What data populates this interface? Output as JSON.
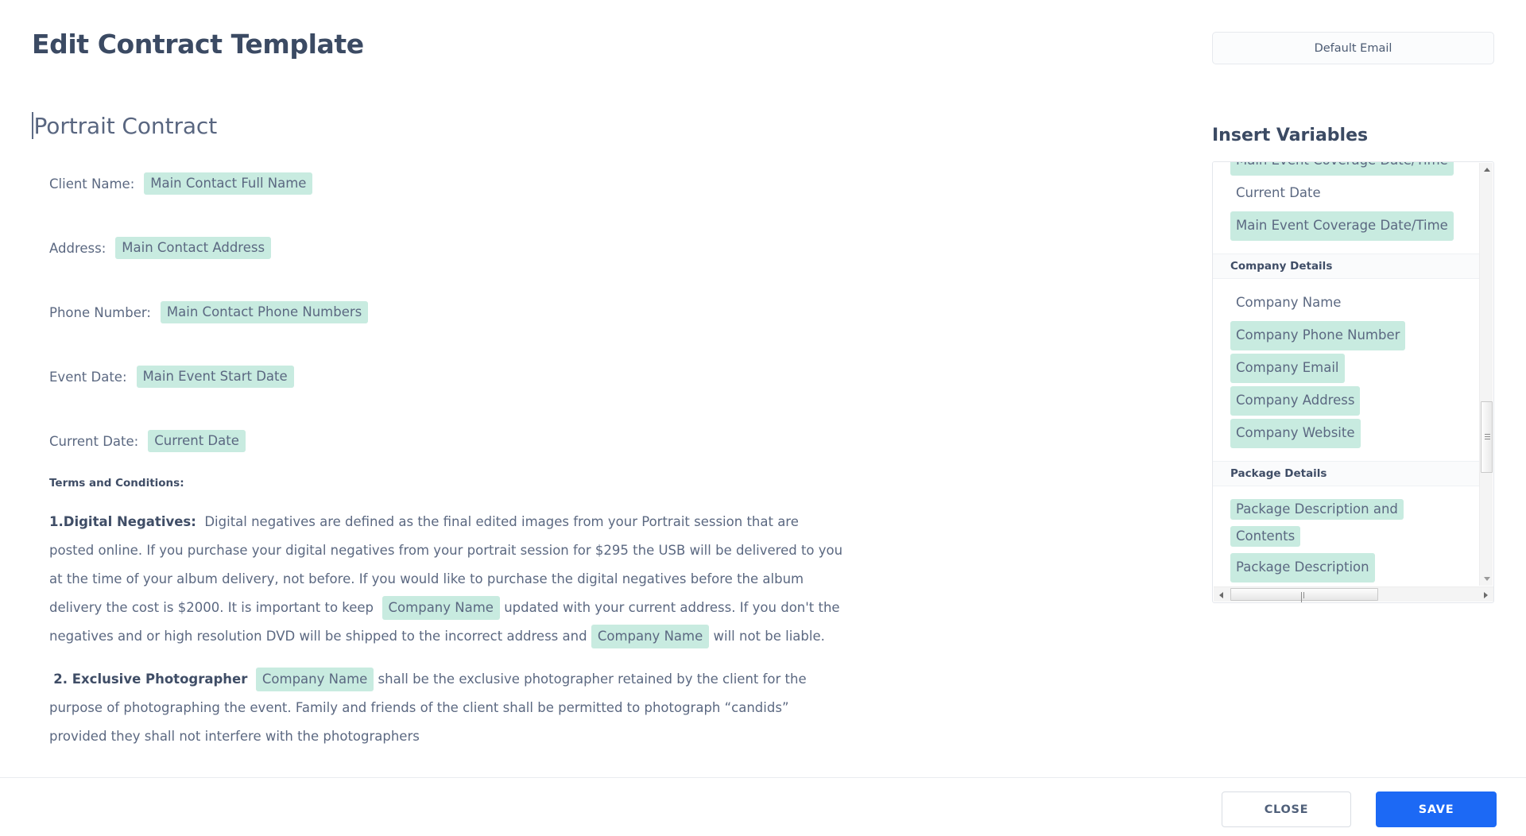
{
  "header": {
    "title": "Edit Contract Template",
    "default_email_label": "Default Email"
  },
  "editor": {
    "document_title": "Portrait Contract",
    "fields": [
      {
        "label": "Client Name:",
        "variable": "Main Contact Full Name"
      },
      {
        "label": "Address:",
        "variable": "Main Contact Address"
      },
      {
        "label": "Phone Number:",
        "variable": "Main Contact Phone Numbers"
      },
      {
        "label": "Event Date:",
        "variable": "Main Event Start Date"
      },
      {
        "label": "Current Date:",
        "variable": "Current Date"
      }
    ],
    "terms_heading": "Terms and Conditions:",
    "clause1": {
      "lead": "1.Digital Negatives:",
      "text_a": "Digital negatives are defined as the final edited images from your Portrait session that are posted online. If you purchase your digital negatives from your portrait session for $295 the USB will be delivered to you at the time of your album delivery, not before.  If you would like to purchase the digital negatives before the album delivery the cost is $2000.  It is important to keep",
      "pill_a": "Company Name",
      "text_b": "updated with your current address.  If you don't the negatives and or high resolution DVD will be shipped to the incorrect address and",
      "pill_b": "Company Name",
      "text_c": "will not be liable."
    },
    "clause2": {
      "lead": "2. Exclusive Photographer",
      "pill": "Company Name",
      "text": "shall be the exclusive photographer retained by the client for the purpose of photographing the event. Family and friends of the client shall be permitted to photograph “candids” provided they shall not interfere with the photographers"
    }
  },
  "variables_panel": {
    "title": "Insert Variables",
    "items": [
      {
        "label": "Main Event Coverage Date/Time",
        "type": "chip",
        "clipped": true
      },
      {
        "label": "Current Date",
        "type": "plain"
      },
      {
        "label": "Main Event Coverage Date/Time",
        "type": "chip"
      },
      {
        "label": "Company Details",
        "type": "group"
      },
      {
        "label": "Company Name",
        "type": "plain"
      },
      {
        "label": "Company Phone Number",
        "type": "chip"
      },
      {
        "label": "Company Email",
        "type": "chip"
      },
      {
        "label": "Company Address",
        "type": "chip"
      },
      {
        "label": "Company Website",
        "type": "chip"
      },
      {
        "label": "Package Details",
        "type": "group"
      },
      {
        "label": "Package Description and Contents",
        "type": "chip-wrap"
      },
      {
        "label": "Package Description",
        "type": "chip"
      }
    ]
  },
  "footer": {
    "close_label": "CLOSE",
    "save_label": "SAVE"
  },
  "colors": {
    "variable_highlight": "#c8ebe0",
    "primary_button": "#1c69f5",
    "heading_text": "#3b4a63",
    "body_text": "#5b6881"
  }
}
